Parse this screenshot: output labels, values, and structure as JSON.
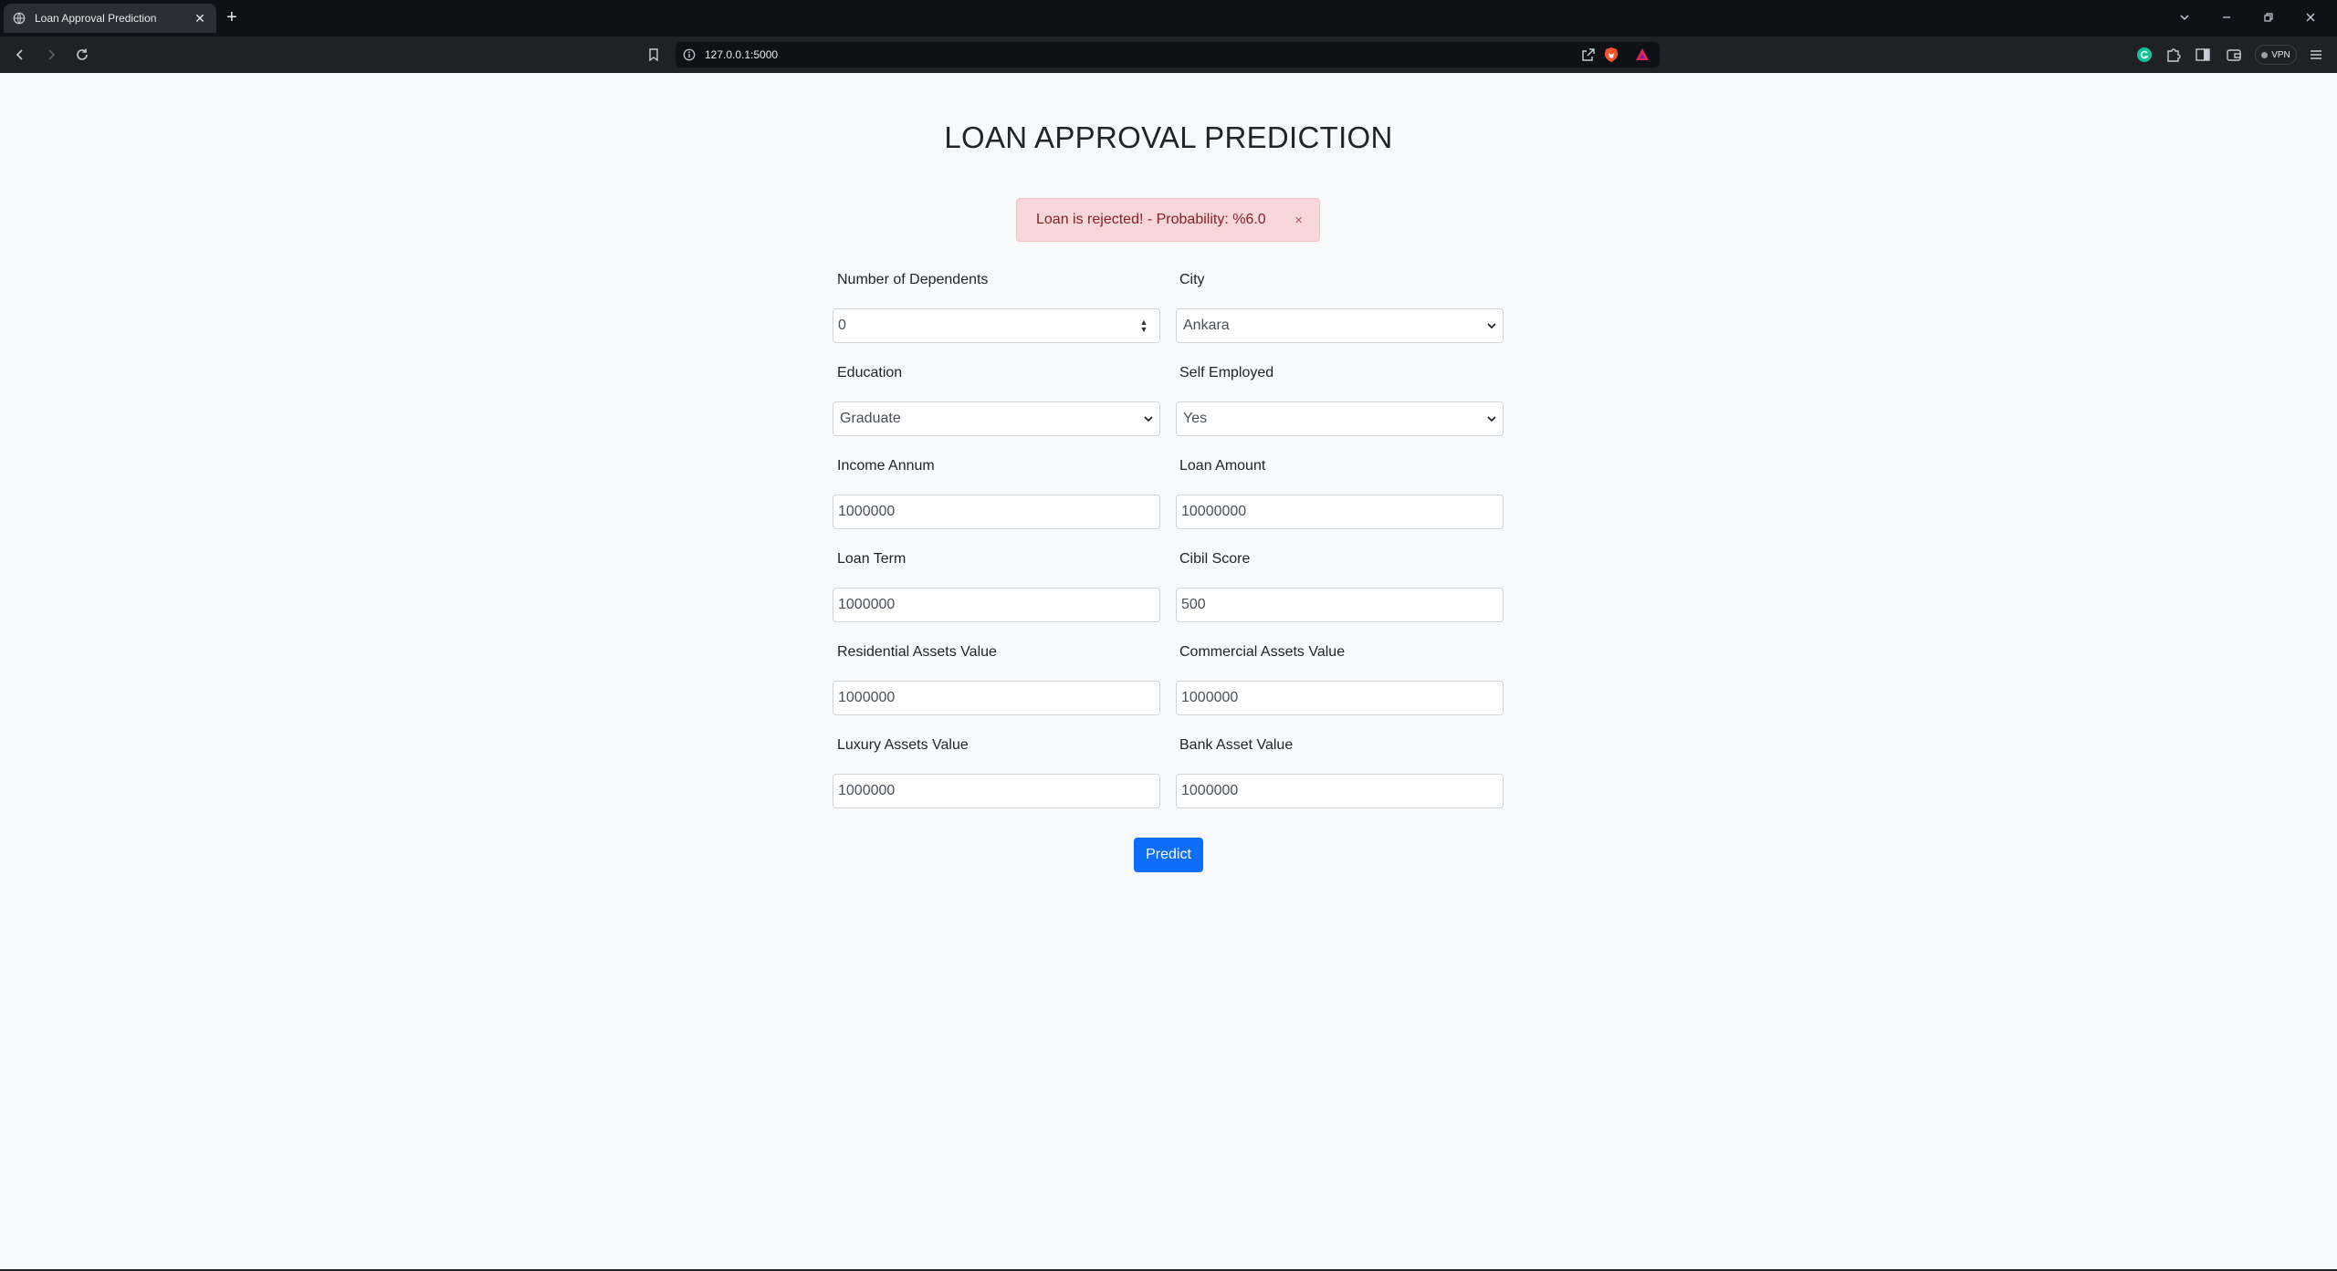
{
  "browser": {
    "tab_title": "Loan Approval Prediction",
    "new_tab": "+",
    "url": "127.0.0.1:5000",
    "vpn_label": "VPN"
  },
  "page": {
    "heading": "LOAN APPROVAL PREDICTION",
    "alert": "Loan is rejected! - Probability: %6.0",
    "alert_close": "×",
    "form": {
      "dependents": {
        "label": "Number of Dependents",
        "value": "0"
      },
      "city": {
        "label": "City",
        "value": "Ankara"
      },
      "education": {
        "label": "Education",
        "value": "Graduate"
      },
      "self_employed": {
        "label": "Self Employed",
        "value": "Yes"
      },
      "income_annum": {
        "label": "Income Annum",
        "value": "1000000"
      },
      "loan_amount": {
        "label": "Loan Amount",
        "value": "10000000"
      },
      "loan_term": {
        "label": "Loan Term",
        "value": "1000000"
      },
      "cibil_score": {
        "label": "Cibil Score",
        "value": "500"
      },
      "residential_assets": {
        "label": "Residential Assets Value",
        "value": "1000000"
      },
      "commercial_assets": {
        "label": "Commercial Assets Value",
        "value": "1000000"
      },
      "luxury_assets": {
        "label": "Luxury Assets Value",
        "value": "1000000"
      },
      "bank_asset": {
        "label": "Bank Asset Value",
        "value": "1000000"
      }
    },
    "predict_button": "Predict"
  },
  "colors": {
    "primary": "#0d6efd",
    "alert_bg": "#f8d7da",
    "alert_text": "#842029",
    "page_bg": "#f8f9fa"
  }
}
